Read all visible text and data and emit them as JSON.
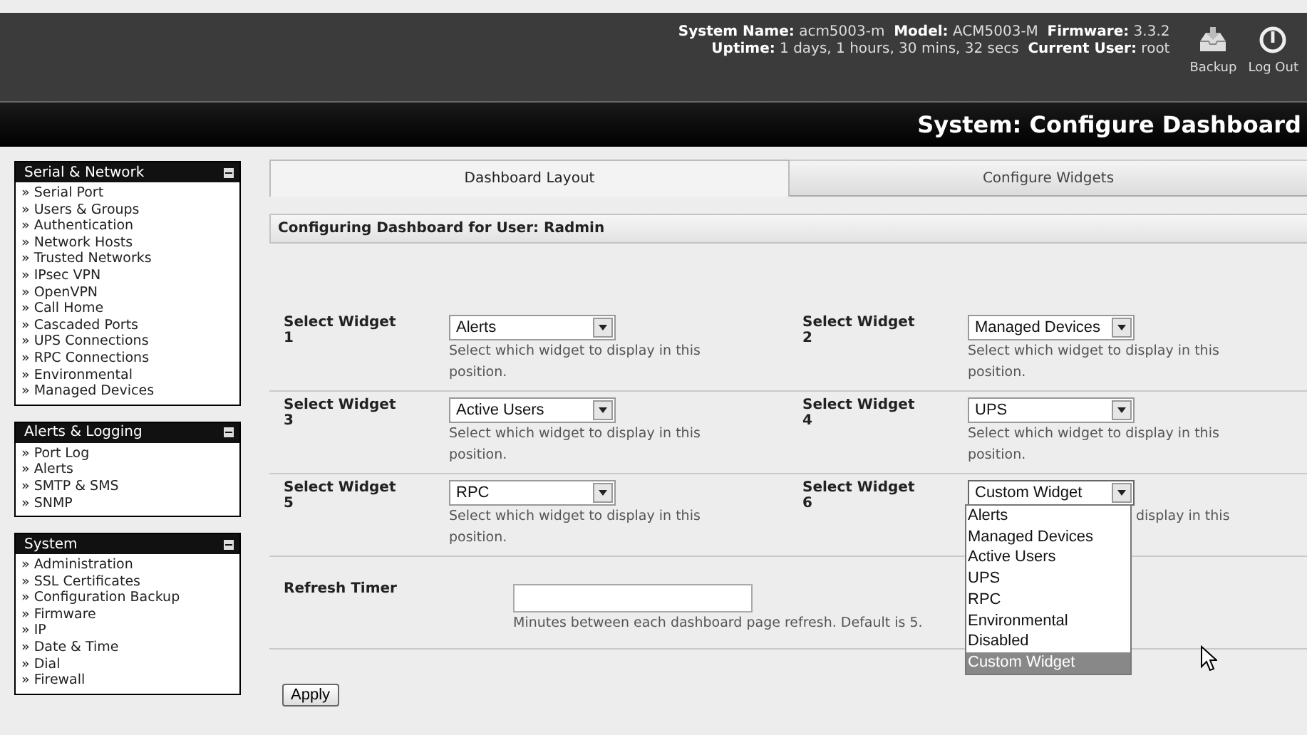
{
  "header": {
    "info_lines": [
      "**System Name:** acm5003-m  **Model:** ACM5003-M  **Firmware:** 3.3.2",
      "**Uptime:** 1 days, 1 hours, 30 mins, 32 secs  **Current User:** root"
    ],
    "actions": [
      {
        "kind": "backup",
        "label": "Backup"
      },
      {
        "kind": "logout",
        "label": "Log Out"
      }
    ],
    "title": "System: Configure Dashboard"
  },
  "sidebar": [
    {
      "title": "Serial & Network",
      "expanded": true,
      "items": [
        "» Serial Port",
        "» Users & Groups",
        "» Authentication",
        "» Network Hosts",
        "» Trusted Networks",
        "» IPsec VPN",
        "» OpenVPN",
        "» Call Home",
        "» Cascaded Ports",
        "» UPS Connections",
        "» RPC Connections",
        "» Environmental",
        "» Managed Devices"
      ]
    },
    {
      "title": "Alerts & Logging",
      "expanded": true,
      "items": [
        "» Port Log",
        "» Alerts",
        "» SMTP & SMS",
        "» SNMP"
      ]
    },
    {
      "title": "System",
      "expanded": true,
      "items": [
        "» Administration",
        "» SSL Certificates",
        "» Configuration Backup",
        "» Firmware",
        "» IP",
        "» Date & Time",
        "» Dial",
        "» Firewall"
      ]
    }
  ],
  "tabs": [
    {
      "label": "Dashboard Layout",
      "selected": true
    },
    {
      "label": "Configure Widgets",
      "selected": false
    }
  ],
  "section_title": "Configuring Dashboard for User: Radmin",
  "widgets": [
    {
      "label": "Select Widget",
      "number": "1",
      "value": "Alerts",
      "description": "Select which widget to display in this position.",
      "open": false
    },
    {
      "label": "Select Widget",
      "number": "2",
      "value": "Managed Devices",
      "description": "Select which widget to display in this position.",
      "open": false
    },
    {
      "label": "Select Widget",
      "number": "3",
      "value": "Active Users",
      "description": "Select which widget to display in this position.",
      "open": false
    },
    {
      "label": "Select Widget",
      "number": "4",
      "value": "UPS",
      "description": "Select which widget to display in this position.",
      "open": false
    },
    {
      "label": "Select Widget",
      "number": "5",
      "value": "RPC",
      "description": "Select which widget to display in this position.",
      "open": false
    },
    {
      "label": "Select Widget",
      "number": "6",
      "value": "Custom Widget",
      "description": "display in this",
      "open": true,
      "options": [
        {
          "label": "Alerts",
          "selected": false
        },
        {
          "label": "Managed Devices",
          "selected": false
        },
        {
          "label": "Active Users",
          "selected": false
        },
        {
          "label": "UPS",
          "selected": false
        },
        {
          "label": "RPC",
          "selected": false
        },
        {
          "label": "Environmental",
          "selected": false
        },
        {
          "label": "Disabled",
          "selected": false
        },
        {
          "label": "Custom Widget",
          "selected": true
        }
      ]
    }
  ],
  "refresh": {
    "label": "Refresh Timer",
    "hint": "Minutes between each dashboard page refresh. Default is 5."
  },
  "apply_button": "Apply"
}
